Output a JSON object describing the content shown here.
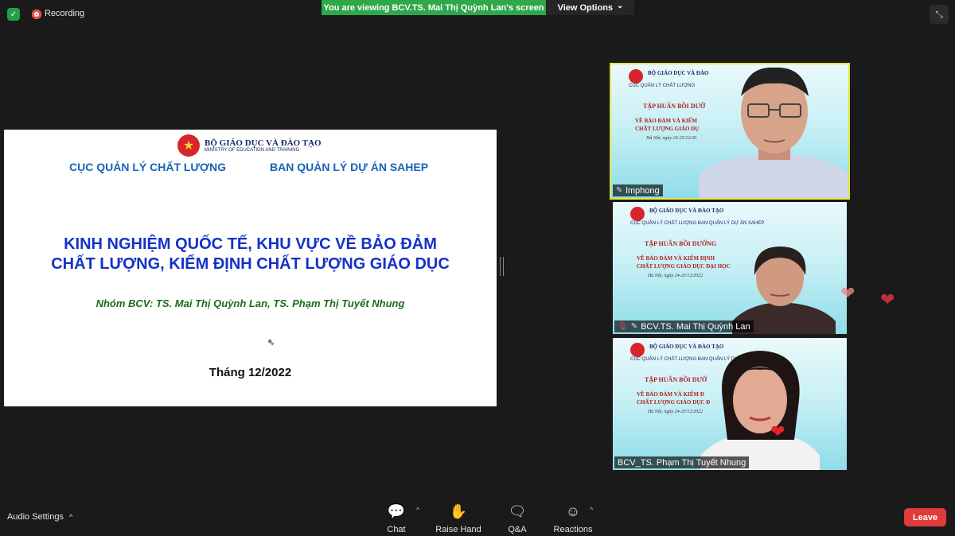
{
  "topbar": {
    "recording_label": "Recording",
    "banner_text": "You are viewing BCV.TS. Mai Thị Quỳnh Lan's screen",
    "view_options_label": "View Options",
    "chevron": "⌄"
  },
  "slide": {
    "org_name": "BỘ GIÁO DỤC VÀ ĐÀO TẠO",
    "org_name_en": "MINISTRY OF EDUCATION AND TRAINING",
    "dept_left": "CỤC QUẢN LÝ CHẤT LƯỢNG",
    "dept_right": "BAN QUẢN LÝ DỰ ÁN SAHEP",
    "title_line1": "KINH NGHIỆM QUỐC TẾ, KHU VỰC VỀ BẢO ĐẢM",
    "title_line2": "CHẤT LƯỢNG, KIỂM ĐỊNH CHẤT LƯỢNG GIÁO DỤC",
    "authors": "Nhóm BCV: TS. Mai Thị Quỳnh Lan, TS. Phạm Thị Tuyết Nhung",
    "date": "Tháng 12/2022"
  },
  "videos": [
    {
      "name": "lmphong",
      "bg_org": "BỘ GIÁO DỤC VÀ ĐÀO",
      "bg_sub": "CỤC QUẢN LÝ CHẤT LƯỢNG",
      "bg_h1": "TẬP HUẤN BỒI DƯỠ",
      "bg_h2a": "VỀ BẢO ĐẢM VÀ KIỂM",
      "bg_h2b": "CHẤT LƯỢNG GIÁO DỤ",
      "bg_h3": "Hà Nội, ngày 24-25/12/20"
    },
    {
      "name": "BCV.TS. Mai Thị Quỳnh Lan",
      "bg_org": "BỘ GIÁO DỤC VÀ ĐÀO TẠO",
      "bg_sub": "CỤC QUẢN LÝ CHẤT LƯỢNG      BAN QUẢN LÝ DỰ ÁN SAHEP",
      "bg_h1": "TẬP HUẤN BỒI DƯỠNG",
      "bg_h2a": "VỀ BẢO ĐẢM VÀ KIỂM ĐỊNH",
      "bg_h2b": "CHẤT LƯỢNG GIÁO DỤC ĐẠI HỌC",
      "bg_h3": "Hà Nội, ngày 24-25/12/2022"
    },
    {
      "name": "BCV_TS. Phạm Thị Tuyết Nhung",
      "bg_org": "BỘ GIÁO DỤC VÀ ĐÀO TẠO",
      "bg_sub": "CỤC QUẢN LÝ CHẤT LƯỢNG      BAN QUẢN LÝ DỰ ÁN SAHEP",
      "bg_h1": "TẬP HUẤN BỒI DƯỠ",
      "bg_h2a": "VỀ BẢO ĐẢM VÀ KIỂM Đ",
      "bg_h2b": "CHẤT LƯỢNG GIÁO DỤC Đ",
      "bg_h3": "Hà Nội, ngày 24-25/12/2022"
    }
  ],
  "toolbar": {
    "audio_settings": "Audio Settings",
    "chat": "Chat",
    "raise_hand": "Raise Hand",
    "qa": "Q&A",
    "reactions": "Reactions",
    "leave": "Leave",
    "caret": "^"
  },
  "colors": {
    "banner_green": "#2ea84a",
    "leave_red": "#e03b3b",
    "active_speaker_border": "#e5e640",
    "slide_title_blue": "#1432c8",
    "authors_green": "#1c6b1c"
  },
  "icons": [
    "shield-icon",
    "record-icon",
    "exit-fullscreen-icon",
    "chat-icon",
    "hand-icon",
    "qa-icon",
    "reactions-icon",
    "mic-muted-icon",
    "pin-icon",
    "heart-icon"
  ]
}
